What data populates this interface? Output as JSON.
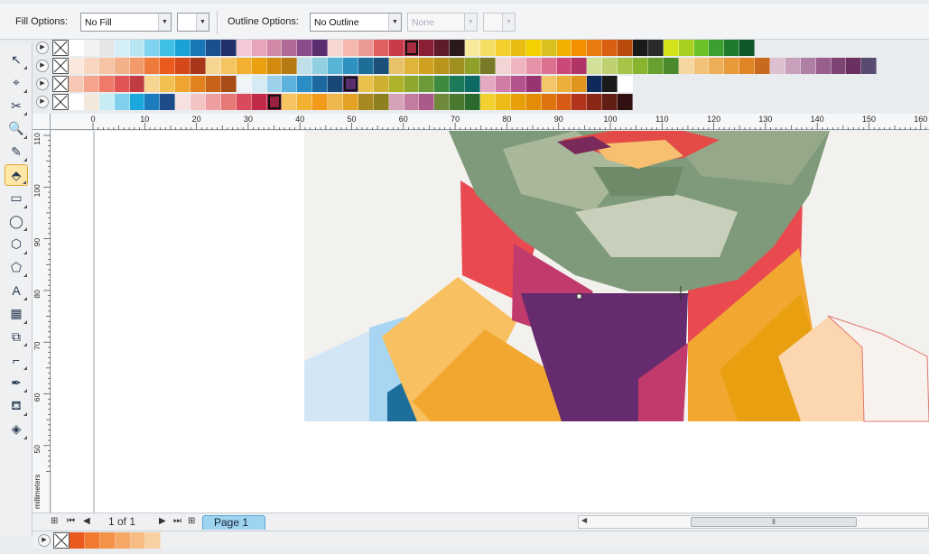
{
  "property_bar": {
    "fill_label": "Fill Options:",
    "fill_value": "No Fill",
    "outline_label": "Outline Options:",
    "outline_value": "No Outline",
    "outline_width": "None"
  },
  "palettes": [
    {
      "colors": [
        "#ffffff",
        "#f2f2f2",
        "#e6e6e6",
        "#d4f0f6",
        "#b8e6f2",
        "#7fd3ee",
        "#40c0e6",
        "#1aa2d6",
        "#1878b6",
        "#1c4f90",
        "#22306a",
        "#f4c8d6",
        "#e8a4b8",
        "#d08aa8",
        "#b06a98",
        "#8a4c8a",
        "#5a2e6e",
        "#f6d6d0",
        "#f4b8b0",
        "#ec9a94",
        "#e06060",
        "#c83a48",
        "#a82a40",
        "#8a2036",
        "#5e1c2a",
        "#2a1a1a",
        "#f8ea9a",
        "#f6df66",
        "#f2cf2a",
        "#e8bc10",
        "#f4d000",
        "#d8c020",
        "#f2b000",
        "#f29000",
        "#e87a10",
        "#d86010",
        "#b84a0c",
        "#1a1a1a",
        "#2a2a2a",
        "#d4e21a",
        "#a8d020",
        "#6cc028",
        "#3ca030",
        "#1e7a2c",
        "#11552a"
      ],
      "selected": 22
    },
    {
      "colors": [
        "#fbe8dc",
        "#f8d6c0",
        "#f6c4a4",
        "#f4b088",
        "#f29a6a",
        "#ee7a3c",
        "#ea5a1c",
        "#d4481a",
        "#a8361a",
        "#f6d690",
        "#f4c460",
        "#f2b030",
        "#eaa010",
        "#d28a0e",
        "#b67a12",
        "#bfe0e8",
        "#90cfe0",
        "#58b4d4",
        "#2e92c0",
        "#1e6e9a",
        "#1d5078",
        "#e8c36a",
        "#dfb43a",
        "#d0a020",
        "#b8941c",
        "#a09020",
        "#90a028",
        "#787a28",
        "#f3d4d4",
        "#eeb4c0",
        "#e692a8",
        "#dc7090",
        "#cc4878",
        "#b03466",
        "#d2e09a",
        "#bed070",
        "#a6c448",
        "#88b430",
        "#66a030",
        "#4a8a2c",
        "#f6d6a0",
        "#f2c27a",
        "#eeae58",
        "#e89a3a",
        "#e08426",
        "#c86a1e",
        "#dcc0d0",
        "#c8a0bc",
        "#b080a4",
        "#985e8c",
        "#7e4474",
        "#6a3060",
        "#584a70"
      ],
      "selected": -1
    },
    {
      "colors": [
        "#f6c8b4",
        "#f4a48c",
        "#ee7a6a",
        "#e05454",
        "#c03c40",
        "#f6d690",
        "#f2c050",
        "#eea430",
        "#e2821e",
        "#c86218",
        "#a84c18",
        "#eef4f8",
        "#d6eaf4",
        "#9cd0ea",
        "#5cb2dc",
        "#2a8ec4",
        "#1c6aa0",
        "#1a4876",
        "#5a2e6e",
        "#e8c24a",
        "#cdb030",
        "#aeb228",
        "#8ea82e",
        "#6c9a36",
        "#3e8a3e",
        "#1a7a5a",
        "#0e6a64",
        "#e4a8c0",
        "#d07ca6",
        "#b4548c",
        "#983470",
        "#f3c66a",
        "#eeae3a",
        "#e0961e",
        "#0e2a5a",
        "#1a1a1a",
        "#ffffff"
      ],
      "selected": 18
    },
    {
      "colors": [
        "#ffffff",
        "#f4e8dc",
        "#c8ecf4",
        "#7ed0ec",
        "#1aa8dc",
        "#1c7cbe",
        "#1e4c8a",
        "#f6e0e0",
        "#f4c4c4",
        "#ee9ea0",
        "#e67878",
        "#d84a5c",
        "#c02a48",
        "#9a2040",
        "#f6c460",
        "#f4b030",
        "#f29a1a",
        "#eeb84e",
        "#e3a126",
        "#a88820",
        "#8e8020",
        "#d6a2b8",
        "#c27ca0",
        "#aa5a88",
        "#6e8a3a",
        "#4a7a30",
        "#2a6a2c",
        "#f2d030",
        "#eebc18",
        "#e8a008",
        "#e48c08",
        "#de7410",
        "#d85a14",
        "#b2341c",
        "#8a2818",
        "#601e14",
        "#301010"
      ],
      "selected": 13
    }
  ],
  "toolbox": [
    {
      "name": "pick-tool-icon",
      "glyph": "↖"
    },
    {
      "name": "shape-tool-icon",
      "glyph": "⌖"
    },
    {
      "name": "crop-tool-icon",
      "glyph": "✂"
    },
    {
      "name": "zoom-tool-icon",
      "glyph": "🔍"
    },
    {
      "name": "freehand-tool-icon",
      "glyph": "✎"
    },
    {
      "name": "smart-fill-tool-icon",
      "glyph": "⬘"
    },
    {
      "name": "rectangle-tool-icon",
      "glyph": "▭"
    },
    {
      "name": "ellipse-tool-icon",
      "glyph": "◯"
    },
    {
      "name": "polygon-tool-icon",
      "glyph": "⬡"
    },
    {
      "name": "basic-shapes-tool-icon",
      "glyph": "⬠"
    },
    {
      "name": "text-tool-icon",
      "glyph": "A"
    },
    {
      "name": "table-tool-icon",
      "glyph": "▦"
    },
    {
      "name": "blend-tool-icon",
      "glyph": "⧉"
    },
    {
      "name": "eyedropper-tool-icon",
      "glyph": "⌐"
    },
    {
      "name": "outline-pen-tool-icon",
      "glyph": "✒"
    },
    {
      "name": "fill-tool-icon",
      "glyph": "⛾"
    },
    {
      "name": "interactive-fill-tool-icon",
      "glyph": "◈"
    }
  ],
  "active_tool": 5,
  "ruler": {
    "h_ticks": [
      "0",
      "10",
      "20",
      "30",
      "40",
      "50",
      "60",
      "70",
      "80",
      "90",
      "100",
      "110",
      "120",
      "130",
      "140",
      "150",
      "160"
    ],
    "v_ticks": [
      "110",
      "100",
      "90",
      "80",
      "70",
      "60",
      "50"
    ],
    "unit": "millimeters"
  },
  "page_nav": {
    "count": "1 of 1",
    "tab": "Page 1"
  },
  "document_palette": [
    "#ea5a1c",
    "#f07a30",
    "#f4924a",
    "#f6a866",
    "#f7bc84",
    "#f8d0a4"
  ]
}
